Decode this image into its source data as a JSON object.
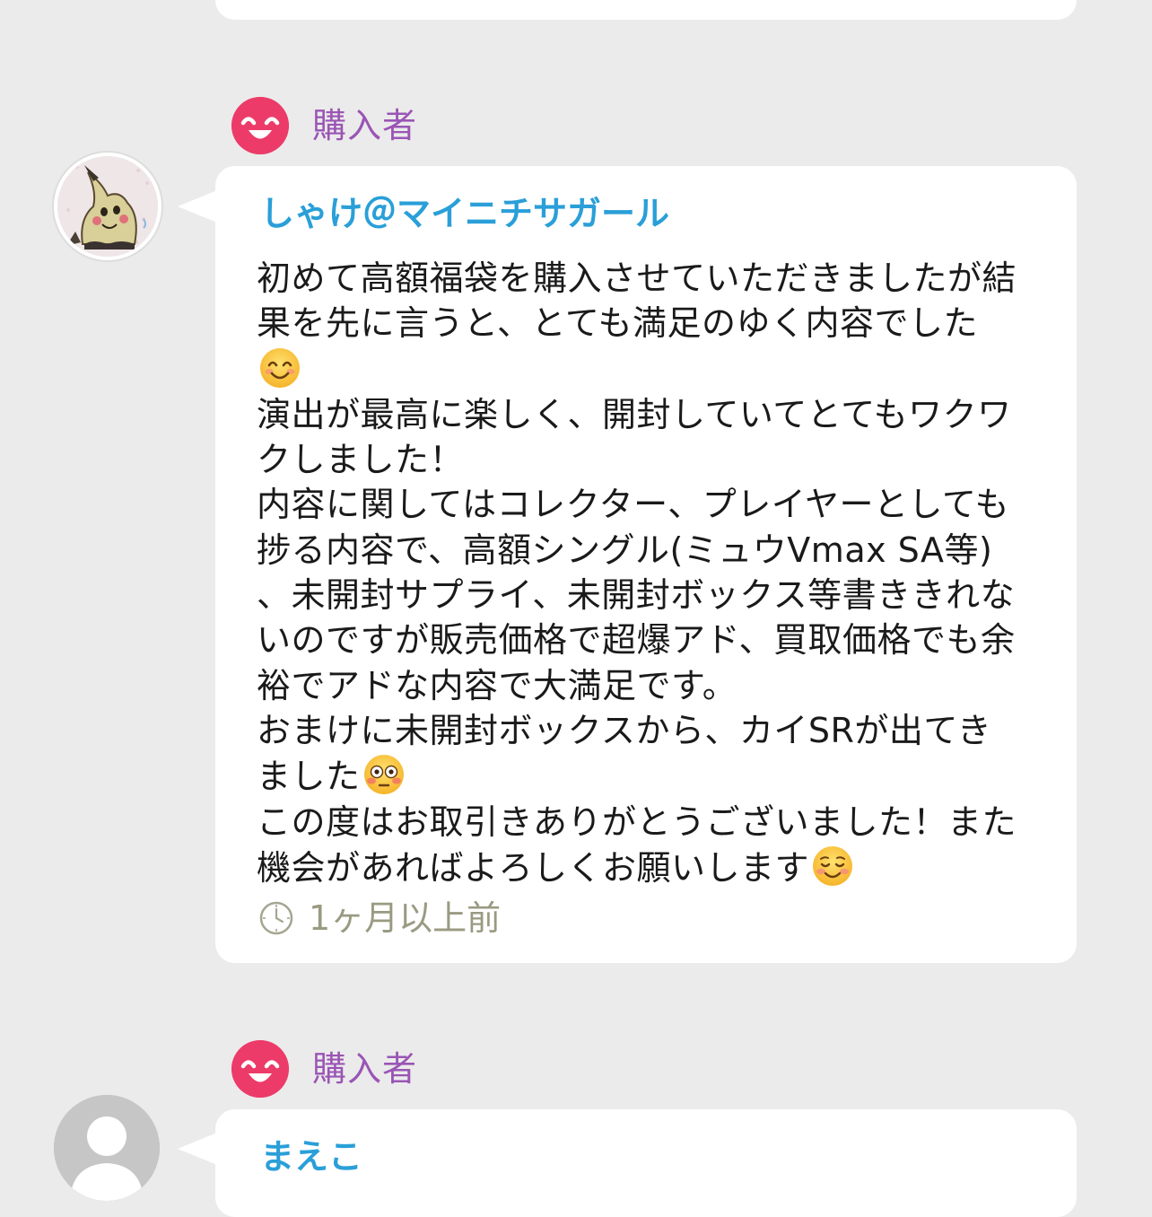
{
  "reviews": [
    {
      "role_label": "購入者",
      "reviewer_name": "しゃけ＠マイニチサガール",
      "body_segments": [
        "初めて高額福袋を購入させていただきましたが結\n果を先に言うと、とても満足のゆく内容でした\n",
        "\n演出が最高に楽しく、開封していてとてもワクワ\nクしました！\n内容に関してはコレクター、プレイヤーとしても\n捗る内容で、高額シングル(ミュウVmax SA等)\n、未開封サプライ、未開封ボックス等書ききれな\nいのですが販売価格で超爆アド、買取価格でも余\n裕でアドな内容で大満足です。\nおまけに未開封ボックスから、カイSRが出てき\nました",
        "\nこの度はお取引きありがとうございました！また\n機会があればよろしくお願いします"
      ],
      "emojis": [
        "smiling-face-with-smiling-eyes",
        "flushed-face",
        "smiling-face"
      ],
      "timestamp": "1ヶ月以上前",
      "avatar": "mimikyu-avatar"
    },
    {
      "role_label": "購入者",
      "reviewer_name": "まえこ",
      "avatar": "default-user-avatar"
    }
  ],
  "colors": {
    "background": "#ebebeb",
    "badge": "#ec3b69",
    "role_label": "#9a55b5",
    "reviewer_name": "#2a9fd8",
    "timestamp": "#9a9a82"
  }
}
